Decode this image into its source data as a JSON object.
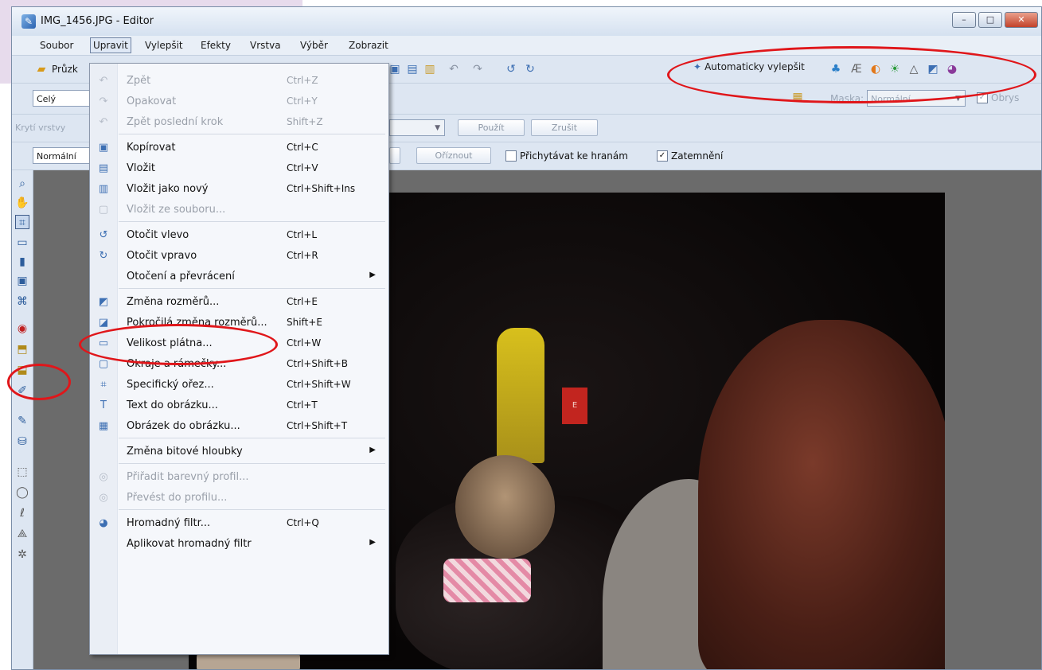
{
  "window": {
    "title": "IMG_1456.JPG - Editor",
    "controls": [
      "–",
      "□",
      "✕"
    ]
  },
  "menubar": [
    "Soubor",
    "Upravit",
    "Vylepšit",
    "Efekty",
    "Vrstva",
    "Výběr",
    "Zobrazit"
  ],
  "toolbar": {
    "browse_label": "Průzk",
    "auto_enhance_label": "Automaticky vylepšit",
    "scope_value": "Celý",
    "mask_label": "Maska:",
    "mask_value": "Normální",
    "outline_label": "Obrys",
    "layer_opacity_label": "Krytí vrstvy",
    "apply_label": "Použít",
    "cancel_label": "Zrušit",
    "blend_value": "Normální",
    "crop_label": "Oříznout",
    "snap_label": "Přichytávat ke hranám",
    "darken_label": "Zatemnění"
  },
  "edit_menu": {
    "items": [
      {
        "label": "Zpět",
        "shortcut": "Ctrl+Z",
        "icon": "undo-icon",
        "disabled": true
      },
      {
        "label": "Opakovat",
        "shortcut": "Ctrl+Y",
        "icon": "redo-icon",
        "disabled": true
      },
      {
        "label": "Zpět poslední krok",
        "shortcut": "Shift+Z",
        "icon": "undo-last-icon",
        "disabled": true
      },
      {
        "label": "Kopírovat",
        "shortcut": "Ctrl+C",
        "icon": "copy-icon",
        "disabled": false
      },
      {
        "label": "Vložit",
        "shortcut": "Ctrl+V",
        "icon": "paste-icon",
        "disabled": false
      },
      {
        "label": "Vložit jako nový",
        "shortcut": "Ctrl+Shift+Ins",
        "icon": "paste-new-icon",
        "disabled": false
      },
      {
        "label": "Vložit ze souboru...",
        "shortcut": "",
        "icon": "paste-file-icon",
        "disabled": true
      },
      {
        "label": "Otočit vlevo",
        "shortcut": "Ctrl+L",
        "icon": "rotate-left-icon",
        "disabled": false
      },
      {
        "label": "Otočit vpravo",
        "shortcut": "Ctrl+R",
        "icon": "rotate-right-icon",
        "disabled": false
      },
      {
        "label": "Otočení a převrácení",
        "shortcut": "",
        "icon": "",
        "disabled": false,
        "submenu": true
      },
      {
        "label": "Změna rozměrů...",
        "shortcut": "Ctrl+E",
        "icon": "resize-icon",
        "disabled": false
      },
      {
        "label": "Pokročilá změna rozměrů...",
        "shortcut": "Shift+E",
        "icon": "advanced-resize-icon",
        "disabled": false
      },
      {
        "label": "Velikost plátna...",
        "shortcut": "Ctrl+W",
        "icon": "canvas-size-icon",
        "disabled": false
      },
      {
        "label": "Okraje a rámečky...",
        "shortcut": "Ctrl+Shift+B",
        "icon": "borders-icon",
        "disabled": false
      },
      {
        "label": "Specifický ořez...",
        "shortcut": "Ctrl+Shift+W",
        "icon": "crop-icon",
        "disabled": false
      },
      {
        "label": "Text do obrázku...",
        "shortcut": "Ctrl+T",
        "icon": "text-icon",
        "disabled": false
      },
      {
        "label": "Obrázek do obrázku...",
        "shortcut": "Ctrl+Shift+T",
        "icon": "image-in-image-icon",
        "disabled": false
      },
      {
        "label": "Změna bitové hloubky",
        "shortcut": "",
        "icon": "",
        "disabled": false,
        "submenu": true
      },
      {
        "label": "Přiřadit barevný profil...",
        "shortcut": "",
        "icon": "color-profile-icon",
        "disabled": true
      },
      {
        "label": "Převést do profilu...",
        "shortcut": "",
        "icon": "convert-profile-icon",
        "disabled": true
      },
      {
        "label": "Hromadný filtr...",
        "shortcut": "Ctrl+Q",
        "icon": "batch-filter-icon",
        "disabled": false
      },
      {
        "label": "Aplikovat hromadný filtr",
        "shortcut": "",
        "icon": "",
        "disabled": false,
        "submenu": true
      }
    ]
  },
  "annotation_color": "#e0161a",
  "photo": {
    "sign_letter": "E"
  }
}
